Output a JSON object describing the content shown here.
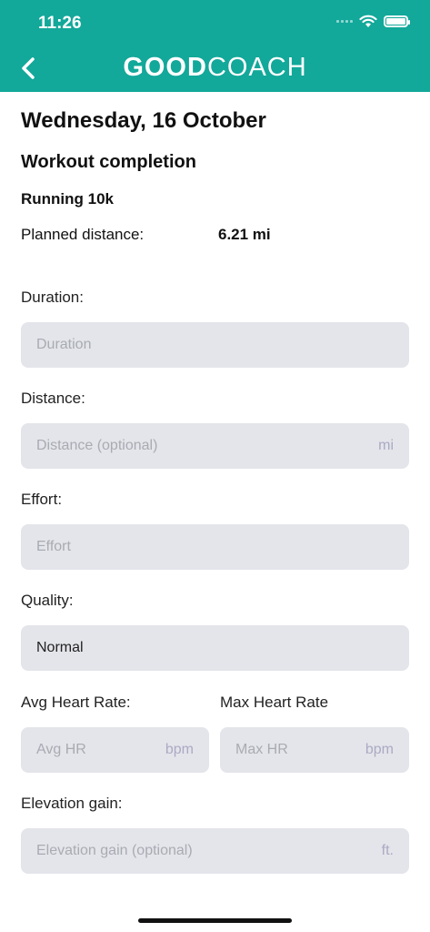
{
  "status_bar": {
    "time": "11:26"
  },
  "header": {
    "brand_bold": "GOOD",
    "brand_light": "COACH"
  },
  "page": {
    "date_title": "Wednesday, 16 October",
    "section_title": "Workout completion",
    "workout_name": "Running 10k",
    "planned_label": "Planned distance:",
    "planned_value": "6.21 mi"
  },
  "form": {
    "duration": {
      "label": "Duration:",
      "placeholder": "Duration"
    },
    "distance": {
      "label": "Distance:",
      "placeholder": "Distance (optional)",
      "unit": "mi"
    },
    "effort": {
      "label": "Effort:",
      "placeholder": "Effort"
    },
    "quality": {
      "label": "Quality:",
      "value": "Normal"
    },
    "avg_hr": {
      "label": "Avg Heart Rate:",
      "placeholder": "Avg HR",
      "unit": "bpm"
    },
    "max_hr": {
      "label": "Max Heart Rate",
      "placeholder": "Max HR",
      "unit": "bpm"
    },
    "elevation": {
      "label": "Elevation gain:",
      "placeholder": "Elevation gain (optional)",
      "unit": "ft."
    }
  },
  "colors": {
    "header": "#12a89a",
    "field_bg": "#e4e5ea"
  }
}
